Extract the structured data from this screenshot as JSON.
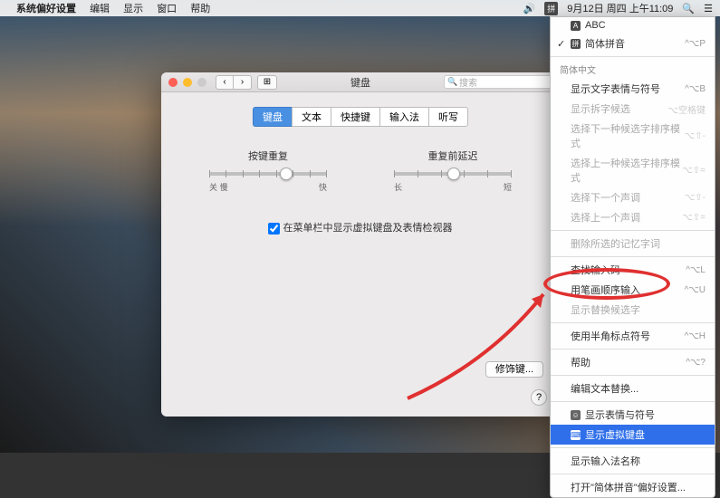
{
  "menubar": {
    "app": "系统偏好设置",
    "items": [
      "编辑",
      "显示",
      "窗口",
      "帮助"
    ],
    "datetime": "9月12日 周四 上午11:09",
    "input_icon": "拼"
  },
  "prefs": {
    "title": "键盘",
    "search_placeholder": "搜索",
    "tabs": [
      "键盘",
      "文本",
      "快捷键",
      "输入法",
      "听写"
    ],
    "slider1": {
      "label": "按键重复",
      "left": "关  慢",
      "right": "快"
    },
    "slider2": {
      "label": "重复前延迟",
      "left": "长",
      "right": "短"
    },
    "checkbox": "在菜单栏中显示虚拟键盘及表情检视器",
    "modifier_btn": "修饰键...",
    "help": "?"
  },
  "dropdown": {
    "inputs": [
      {
        "label": "ABC",
        "icon_bg": "#4a4a4a",
        "icon_text": "A",
        "shortcut": ""
      },
      {
        "label": "简体拼音",
        "icon_bg": "#4a4a4a",
        "icon_text": "拼",
        "checked": true,
        "shortcut": "^⌥P"
      }
    ],
    "section": "简体中文",
    "group1": [
      {
        "label": "显示文字表情与符号",
        "shortcut": "^⌥B"
      },
      {
        "label": "显示拆字候选",
        "shortcut": "⌥空格键",
        "disabled": true
      },
      {
        "label": "选择下一种候选字排序模式",
        "shortcut": "⌥⇧-",
        "disabled": true
      },
      {
        "label": "选择上一种候选字排序模式",
        "shortcut": "⌥⇧=",
        "disabled": true
      },
      {
        "label": "选择下一个声调",
        "shortcut": "⌥⇧-",
        "disabled": true
      },
      {
        "label": "选择上一个声调",
        "shortcut": "⌥⇧=",
        "disabled": true
      }
    ],
    "group2": [
      {
        "label": "删除所选的记忆字词",
        "disabled": true
      }
    ],
    "group3": [
      {
        "label": "查找输入码",
        "shortcut": "^⌥L"
      },
      {
        "label": "用笔画顺序输入",
        "shortcut": "^⌥U"
      },
      {
        "label": "显示替换候选字",
        "disabled": true
      }
    ],
    "group4": [
      {
        "label": "使用半角标点符号",
        "shortcut": "^⌥H"
      }
    ],
    "group5": [
      {
        "label": "帮助",
        "shortcut": "^⌥?"
      }
    ],
    "group6": [
      {
        "label": "编辑文本替换..."
      }
    ],
    "group7": [
      {
        "label": "显示表情与符号",
        "icon": true
      },
      {
        "label": "显示虚拟键盘",
        "icon": true,
        "highlighted": true
      }
    ],
    "group8": [
      {
        "label": "显示输入法名称"
      }
    ],
    "group9": [
      {
        "label": "打开\"简体拼音\"偏好设置..."
      }
    ]
  }
}
